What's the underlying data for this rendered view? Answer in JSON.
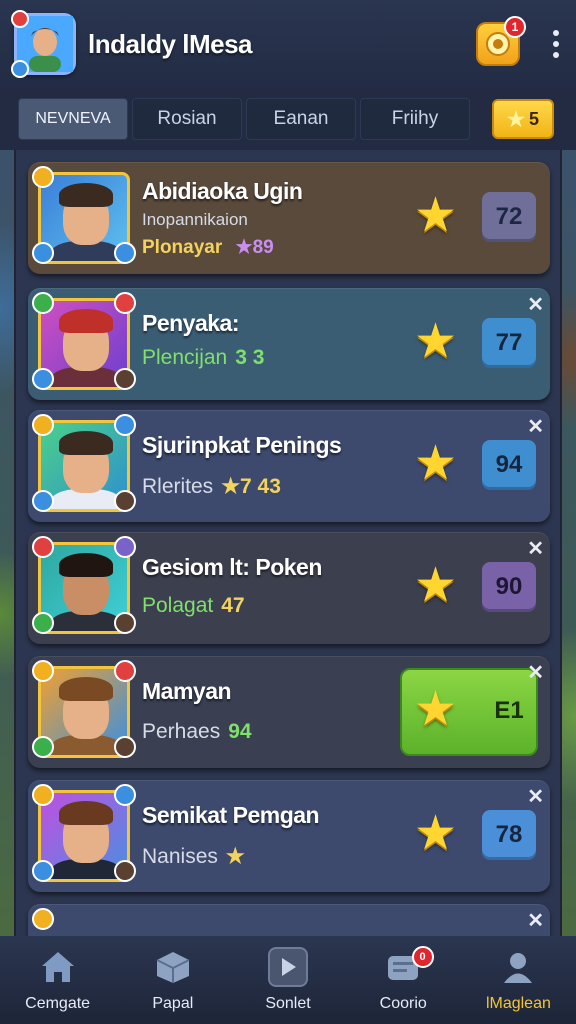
{
  "header": {
    "title": "lndaldy lMesa",
    "notification_count": "1"
  },
  "tabs": [
    {
      "label": "NEVNEVA",
      "active": true
    },
    {
      "label": "Rosian",
      "active": false
    },
    {
      "label": "Eanan",
      "active": false
    },
    {
      "label": "Friihy",
      "active": false
    }
  ],
  "coins": {
    "value": "5"
  },
  "cards": [
    {
      "name": "Abidiaoka Ugin",
      "sub": "Inopannikaion",
      "meta_label": "Plonayar",
      "meta_value": "★89",
      "score": "72",
      "bg": "#5a4a3c",
      "score_bg": "#6f6f9a"
    },
    {
      "name": "Penyaka:",
      "meta_label": "Plencijan",
      "meta_value": "3 3",
      "score": "77",
      "bg": "#3b5d74",
      "score_bg": "#3f8fd0"
    },
    {
      "name": "Sjurinpkat Penings",
      "meta_label": "Rlerites",
      "meta_value": "★7 43",
      "score": "94",
      "bg": "#3d4a6e",
      "score_bg": "#3f8fd0"
    },
    {
      "name": "Gesiom lt: Poken",
      "meta_label": "Polagat",
      "meta_value": "47",
      "score": "90",
      "bg": "#3c3f4e",
      "score_bg": "#7a62a8"
    },
    {
      "name": "Mamyan",
      "meta_label": "Perhaes",
      "meta_value": "94",
      "score": "E1",
      "bg": "#3a3f52",
      "score_bg": "#67b932"
    },
    {
      "name": "Semikat Pemgan",
      "meta_label": "Nanises",
      "meta_value": "★",
      "score": "78",
      "bg": "#3d4a6e",
      "score_bg": "#4a8fd8"
    }
  ],
  "nav": [
    {
      "label": "Cemgate",
      "icon": "home-icon",
      "active": false
    },
    {
      "label": "Papal",
      "icon": "box-icon",
      "active": false
    },
    {
      "label": "Sonlet",
      "icon": "play-icon",
      "active": false
    },
    {
      "label": "Coorio",
      "icon": "chat-icon",
      "active": false,
      "badge": "0"
    },
    {
      "label": "lMaglean",
      "icon": "profile-icon",
      "active": true
    }
  ]
}
